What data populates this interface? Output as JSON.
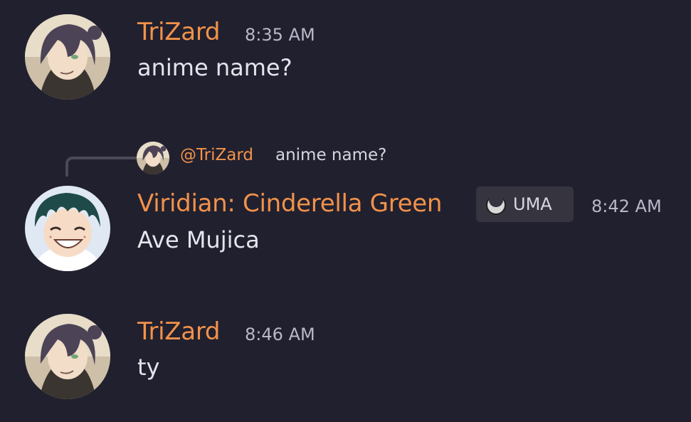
{
  "messages": [
    {
      "author": "TriZard",
      "time": "8:35 AM",
      "content": "anime name?"
    },
    {
      "author": "Viridian: Cinderella Green",
      "time": "8:42 AM",
      "content": "Ave Mujica",
      "badge": {
        "label": "UMA",
        "icon": "crescent-moon-icon"
      },
      "reply": {
        "author": "@TriZard",
        "text": "anime name?"
      }
    },
    {
      "author": "TriZard",
      "time": "8:46 AM",
      "content": "ty"
    }
  ],
  "colors": {
    "background": "#21202f",
    "author": "#f2924a",
    "timestamp": "#b9b8c9",
    "text": "#e4e4ec",
    "badge_bg": "#35343f"
  }
}
